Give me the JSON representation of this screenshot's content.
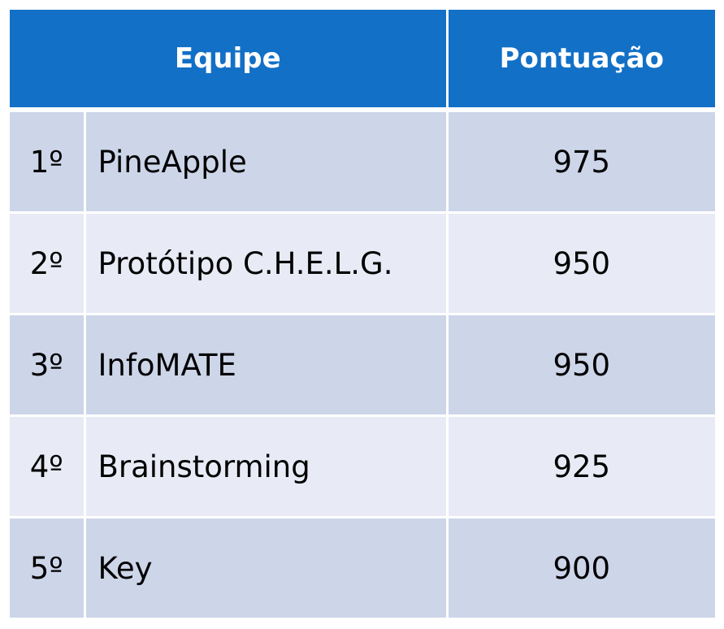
{
  "table": {
    "headers": {
      "team": "Equipe",
      "score": "Pontuação"
    },
    "rows": [
      {
        "rank": "1º",
        "team": "PineApple",
        "score": "975"
      },
      {
        "rank": "2º",
        "team": "Protótipo C.H.E.L.G.",
        "score": "950"
      },
      {
        "rank": "3º",
        "team": "InfoMATE",
        "score": "950"
      },
      {
        "rank": "4º",
        "team": "Brainstorming",
        "score": "925"
      },
      {
        "rank": "5º",
        "team": "Key",
        "score": "900"
      }
    ],
    "colors": {
      "header_background": "#1270c6",
      "row_odd_background": "#cdd5e9",
      "row_even_background": "#e8ebf5"
    }
  }
}
